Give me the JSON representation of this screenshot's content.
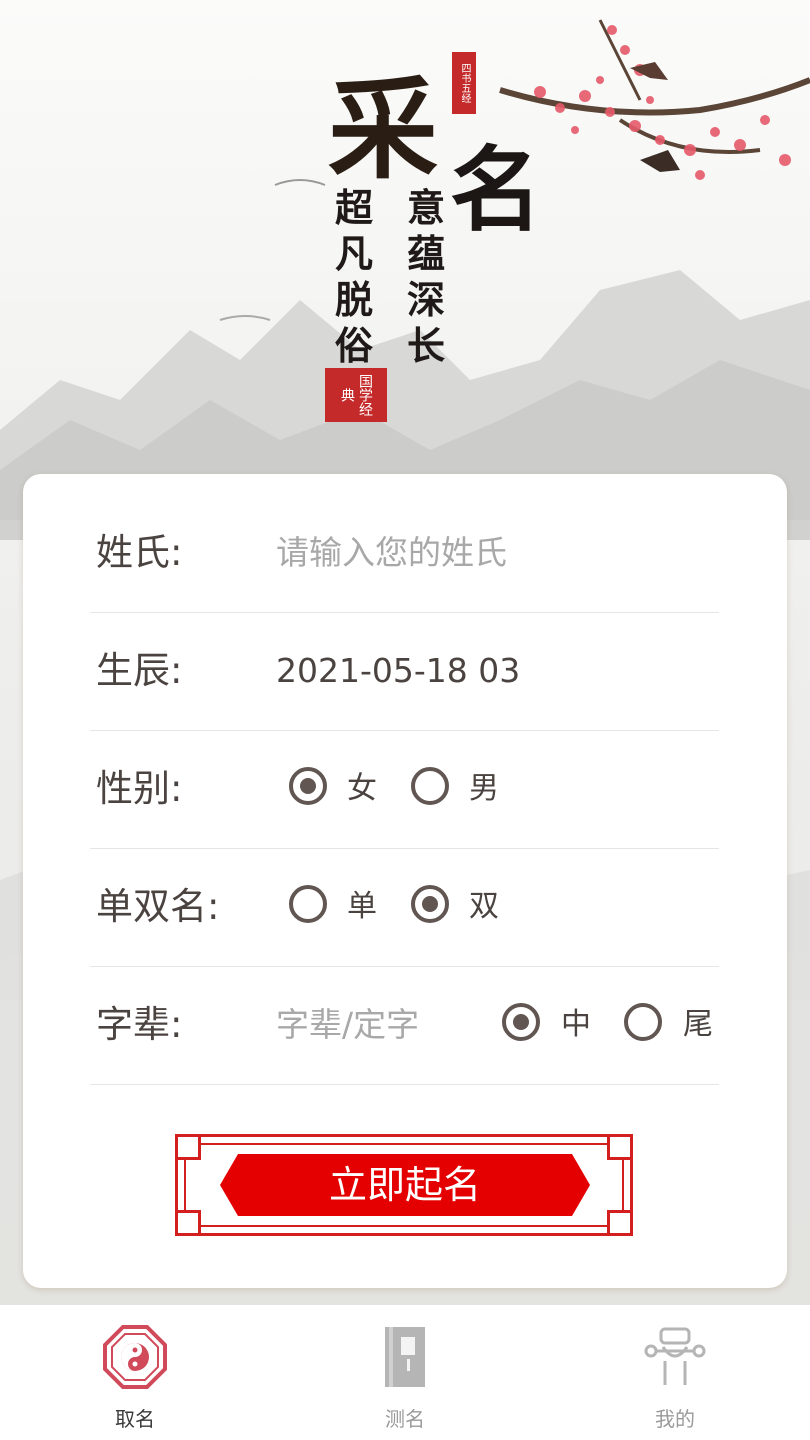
{
  "hero": {
    "title_char1": "采",
    "title_char2": "名",
    "slogan_left": [
      "超",
      "凡",
      "脱",
      "俗"
    ],
    "slogan_right": [
      "意",
      "蕴",
      "深",
      "长"
    ],
    "seal_top": "四书五经",
    "seal_bottom": "国学经典"
  },
  "form": {
    "surname_label": "姓氏:",
    "surname_placeholder": "请输入您的姓氏",
    "birth_label": "生辰:",
    "birth_value": "2021-05-18 03",
    "gender_label": "性别:",
    "gender_female": "女",
    "gender_male": "男",
    "gender_selected": "女",
    "name_length_label": "单双名:",
    "name_single": "单",
    "name_double": "双",
    "name_length_selected": "双",
    "generation_label": "字辈:",
    "generation_placeholder": "字辈/定字",
    "position_middle": "中",
    "position_end": "尾",
    "position_selected": "中",
    "submit_label": "立即起名"
  },
  "tabbar": {
    "tabs": [
      {
        "label": "取名",
        "icon": "bagua-icon",
        "active": true,
        "color": "#3a3a3a"
      },
      {
        "label": "测名",
        "icon": "book-icon",
        "active": false,
        "color": "#9a9a9a"
      },
      {
        "label": "我的",
        "icon": "profile-icon",
        "active": false,
        "color": "#9a9a9a"
      }
    ]
  },
  "colors": {
    "accent_red": "#e40000",
    "text_brown": "#4a4340",
    "radio_brown": "#615652"
  }
}
